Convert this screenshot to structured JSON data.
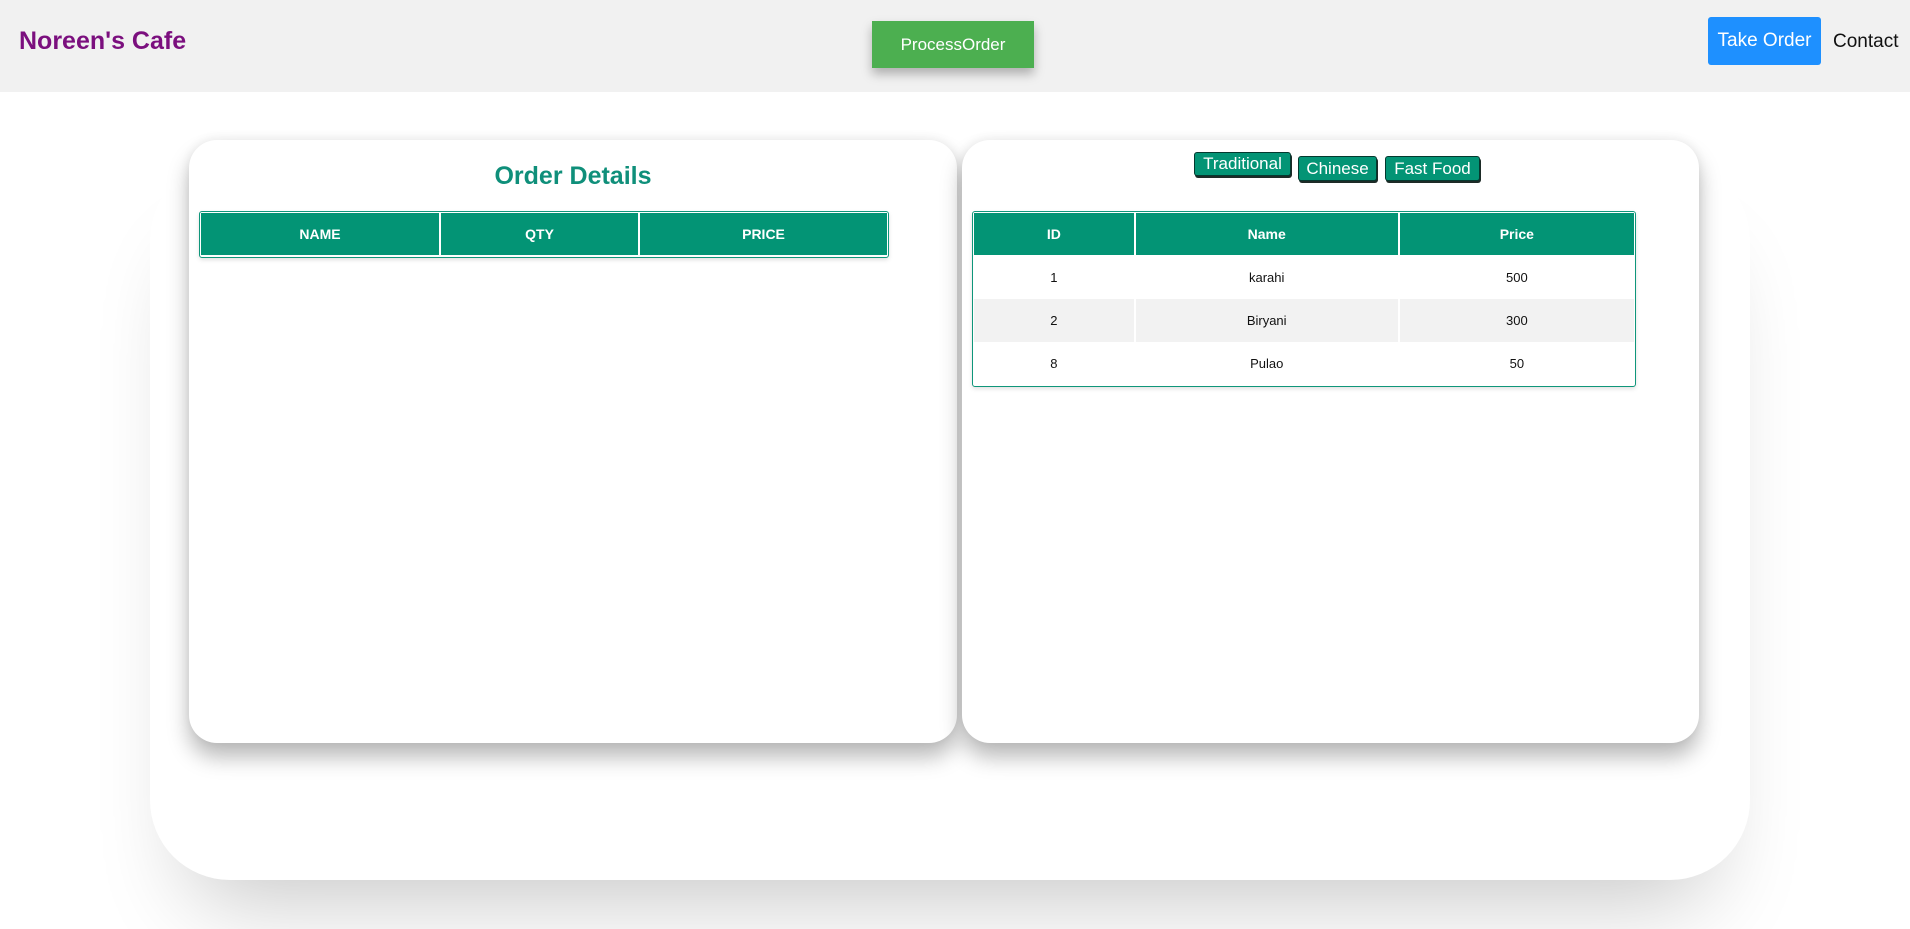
{
  "header": {
    "brand": "Noreen's Cafe",
    "process_label": "ProcessOrder",
    "take_order_label": "Take Order",
    "contact_label": "Contact"
  },
  "order": {
    "title": "Order Details",
    "columns": [
      "NAME",
      "QTY",
      "PRICE"
    ],
    "rows": []
  },
  "menu": {
    "categories": [
      "Traditional",
      "Chinese",
      "Fast Food"
    ],
    "columns": [
      "ID",
      "Name",
      "Price"
    ],
    "rows": [
      {
        "id": "1",
        "name": "karahi",
        "price": "500"
      },
      {
        "id": "2",
        "name": "Biryani",
        "price": "300"
      },
      {
        "id": "8",
        "name": "Pulao",
        "price": "50"
      }
    ]
  },
  "colors": {
    "brand": "#7b0f7e",
    "teal": "#039475",
    "process": "#4caf50",
    "take_order": "#1e90ff"
  }
}
